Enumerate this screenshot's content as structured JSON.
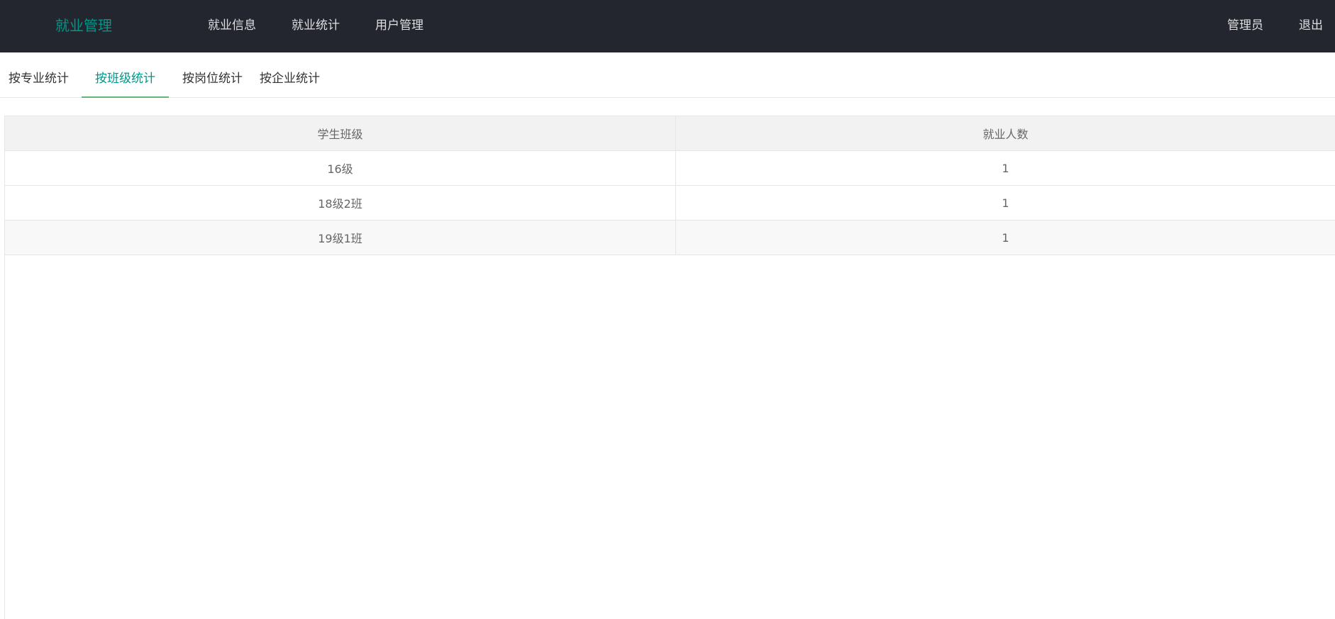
{
  "header": {
    "logo": "就业管理",
    "nav": [
      "就业信息",
      "就业统计",
      "用户管理"
    ],
    "user": "管理员",
    "logout": "退出"
  },
  "tabs": [
    {
      "label": "按专业统计",
      "active": false
    },
    {
      "label": "按班级统计",
      "active": true
    },
    {
      "label": "按岗位统计",
      "active": false
    },
    {
      "label": "按企业统计",
      "active": false
    }
  ],
  "table": {
    "columns": [
      "学生班级",
      "就业人数"
    ],
    "rows": [
      [
        "16级",
        "1"
      ],
      [
        "18级2班",
        "1"
      ],
      [
        "19级1班",
        "1"
      ]
    ]
  },
  "colors": {
    "topbar": "#23262e",
    "accent": "#009688",
    "tab_underline": "#5FB878"
  }
}
